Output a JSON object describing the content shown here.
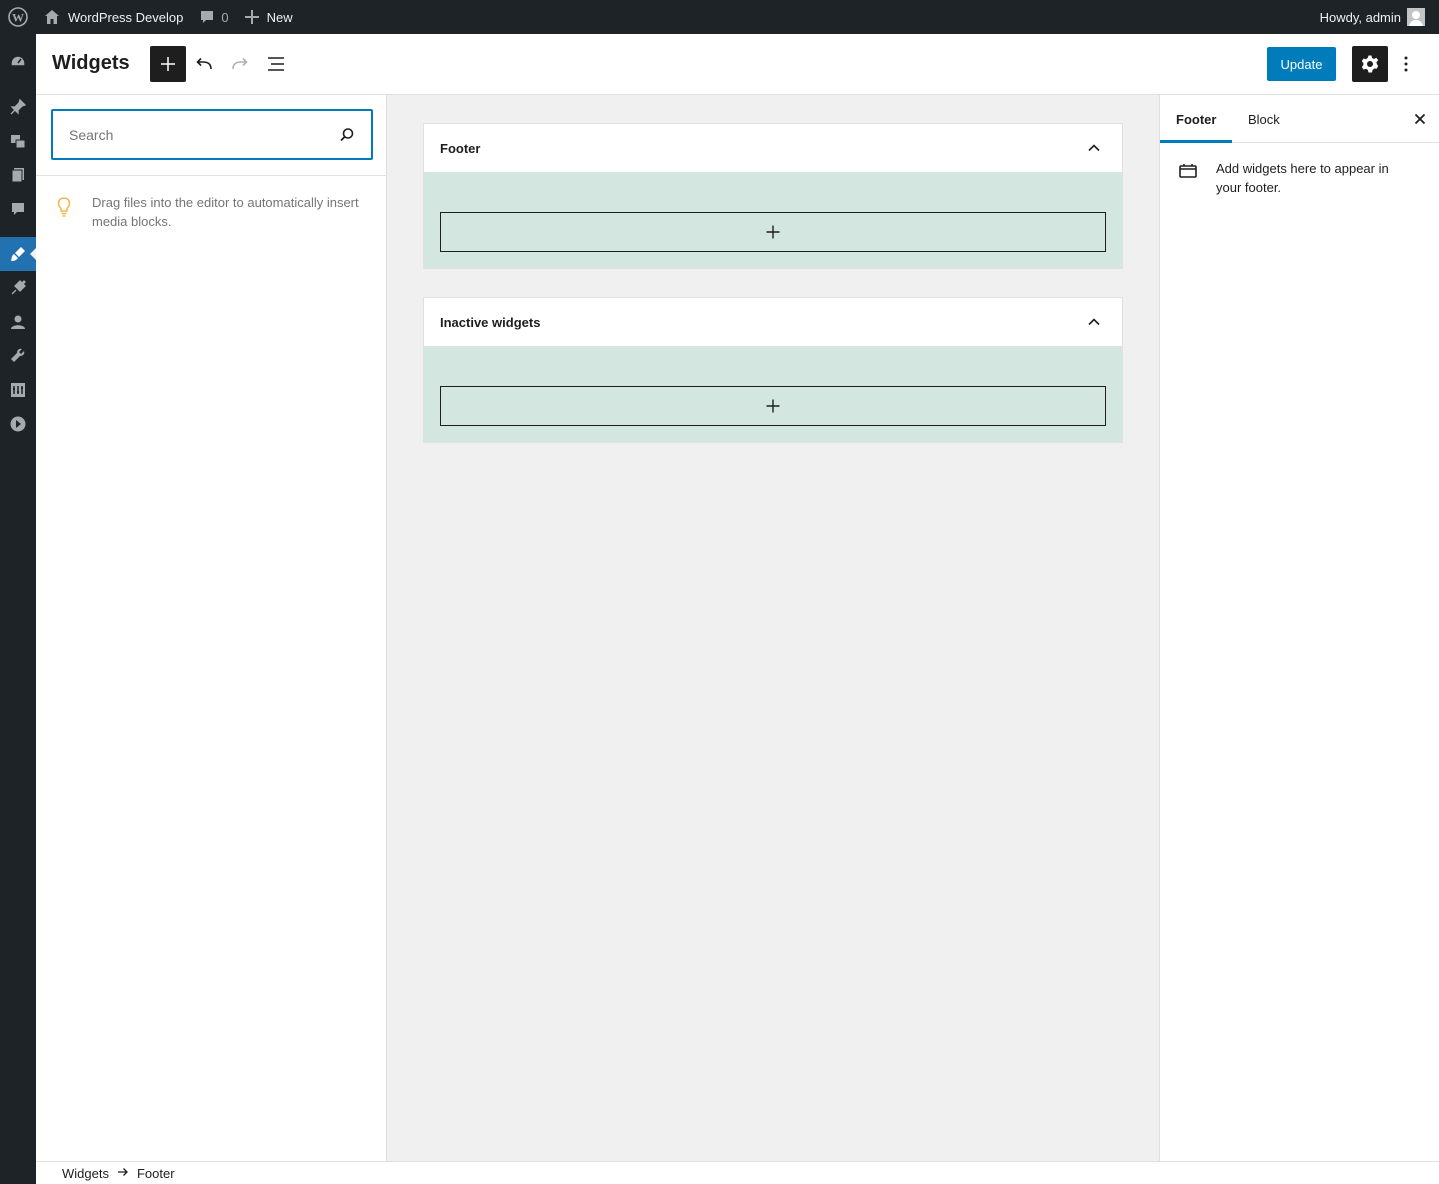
{
  "admin_bar": {
    "site_name": "WordPress Develop",
    "comments_count": "0",
    "new_label": "New",
    "greeting": "Howdy, admin"
  },
  "admin_menu": {
    "icons": [
      "dashboard-icon",
      "posts-icon",
      "media-icon",
      "pages-icon",
      "comments-icon",
      "appearance-icon",
      "plugins-icon",
      "users-icon",
      "tools-icon",
      "settings-icon",
      "collapse-icon"
    ],
    "active": "appearance-icon"
  },
  "header": {
    "title": "Widgets",
    "update_label": "Update"
  },
  "inserter": {
    "search_placeholder": "Search",
    "tip": "Drag files into the editor to automatically insert media blocks."
  },
  "widget_areas": [
    {
      "title": "Footer"
    },
    {
      "title": "Inactive widgets"
    }
  ],
  "sidebar": {
    "tabs": [
      "Footer",
      "Block"
    ],
    "active_tab": "Footer",
    "description": "Add widgets here to appear in your footer."
  },
  "breadcrumb": {
    "items": [
      "Widgets",
      "Footer"
    ]
  },
  "colors": {
    "admin_bar_bg": "#1d2327",
    "accent": "#007cba",
    "widget_area_bg": "#d3e6e0",
    "tip_bulb": "#f0b849"
  }
}
